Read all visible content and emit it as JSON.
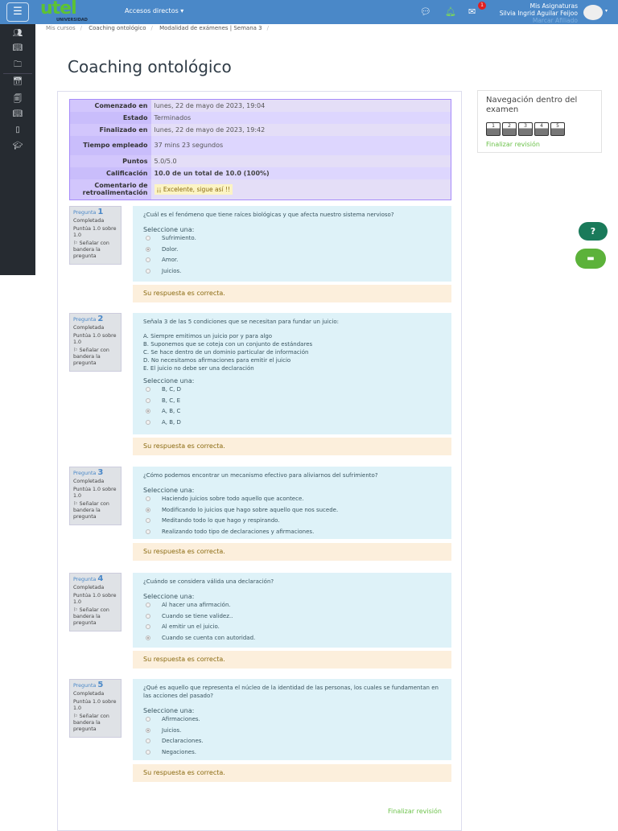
{
  "header": {
    "menu_icon": "hamburger-icon",
    "logo": "utel",
    "logo_sub": "UNIVERSIDAD",
    "accesos": "Accesos directos",
    "messages_badge": "1",
    "user_top": "Mis Asignaturas",
    "user_name": "Silvia Ingrid Aguilar Feijoo",
    "user_role": "Marcar Afiliado"
  },
  "breadcrumb": [
    "Mis cursos",
    "Coaching ontológico",
    "Modalidad de exámenes | Semana 3"
  ],
  "title": "Coaching ontológico",
  "summary": [
    {
      "k": "Comenzado en",
      "v": "lunes, 22 de mayo de 2023, 19:04"
    },
    {
      "k": "Estado",
      "v": "Terminados"
    },
    {
      "k": "Finalizado en",
      "v": "lunes, 22 de mayo de 2023, 19:42"
    },
    {
      "k": "Tiempo empleado",
      "v": "37 mins 23 segundos"
    },
    {
      "k": "Puntos",
      "v": "5.0/5.0"
    },
    {
      "k": "Calificación",
      "v": "10.0 de un total de 10.0 (100%)"
    },
    {
      "k": "Comentario de retroalimentación",
      "v": "¡¡ Excelente, sigue así !!"
    }
  ],
  "info": {
    "pregunta": "Pregunta",
    "estado": "Completada",
    "puntua": "Puntúa 1.0 sobre 1.0",
    "flag": "Señalar con bandera la pregunta"
  },
  "select_label": "Seleccione una:",
  "feedback": "Su respuesta es correcta.",
  "questions": [
    {
      "n": "1",
      "text": "¿Cuál es el fenómeno que tiene raíces biológicas y que afecta nuestro sistema nervioso?",
      "lines": [],
      "options": [
        "Sufrimiento.",
        "Dolor.",
        "Amor.",
        "Juicios."
      ],
      "selected": 1
    },
    {
      "n": "2",
      "text": "Señala 3 de las 5 condiciones que se necesitan para fundar un juicio:",
      "lines": [
        "A. Siempre emitimos un juicio por y para algo",
        "B. Suponemos que se coteja con un conjunto de estándares",
        "C. Se hace dentro de un dominio particular de información",
        "D. No necesitamos afirmaciones para emitir el juicio",
        "E. El juicio no debe ser una declaración"
      ],
      "options": [
        "B, C, D",
        "B, C, E",
        "A, B, C",
        "A, B, D"
      ],
      "selected": 2
    },
    {
      "n": "3",
      "text": "¿Cómo podemos encontrar un mecanismo efectivo para aliviarnos del sufrimiento?",
      "lines": [],
      "options": [
        "Haciendo juicios sobre todo aquello que acontece.",
        "Modificando lo juicios que hago sobre aquello que nos sucede.",
        "Meditando todo lo que hago y respirando.",
        "Realizando todo tipo de declaraciones y afirmaciones."
      ],
      "selected": 1
    },
    {
      "n": "4",
      "text": "¿Cuándo se considera válida una declaración?",
      "lines": [],
      "options": [
        "Al hacer una afirmación.",
        "Cuando se tiene validez..",
        "Al emitir un el juicio.",
        "Cuando se cuenta con autoridad."
      ],
      "selected": 3
    },
    {
      "n": "5",
      "text": "¿Qué es aquello que representa el núcleo de la identidad de las personas, los cuales se fundamentan en las acciones del pasado?",
      "lines": [],
      "options": [
        "Afirmaciones.",
        "Juicios.",
        "Declaraciones.",
        "Negaciones."
      ],
      "selected": 1
    }
  ],
  "nav": {
    "title": "Navegación dentro del examen",
    "buttons": [
      "1",
      "2",
      "3",
      "4",
      "5"
    ],
    "finish": "Finalizar revisión"
  },
  "finish_bottom": "Finalizar revisión",
  "help": "?"
}
